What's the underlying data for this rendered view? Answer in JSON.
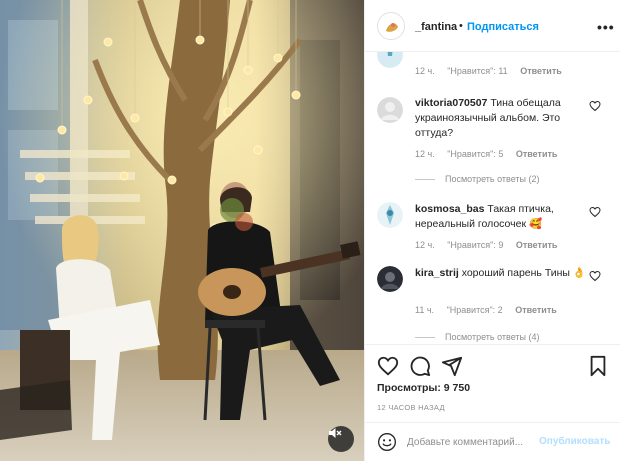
{
  "post": {
    "username": "_fantina",
    "separator": "•",
    "follow_label": "Подписаться",
    "more_label": "•••"
  },
  "comments": [
    {
      "partial": true,
      "meta": {
        "time": "12 ч.",
        "likes": "\"Нравится\": 11",
        "reply": "Ответить"
      }
    },
    {
      "username": "viktoria070507",
      "text": "Тина обещала украиноязычный альбом. Это оттуда?",
      "meta": {
        "time": "12 ч.",
        "likes": "\"Нравится\": 5",
        "reply": "Ответить"
      },
      "view_replies": "Посмотреть ответы (2)"
    },
    {
      "username": "kosmosa_bas",
      "text": "Такая птичка, нереальный голосочек 🥰",
      "meta": {
        "time": "12 ч.",
        "likes": "\"Нравится\": 9",
        "reply": "Ответить"
      }
    },
    {
      "username": "kira_strij",
      "text": "хороший парень Тины 👌",
      "meta": {
        "time": "11 ч.",
        "likes": "\"Нравится\": 2",
        "reply": "Ответить"
      },
      "view_replies": "Посмотреть ответы (4)"
    }
  ],
  "stats": {
    "views": "Просмотры: 9 750",
    "time_ago": "12 ЧАСОВ НАЗАД"
  },
  "add_comment": {
    "placeholder": "Добавьте комментарий...",
    "publish_label": "Опубликовать"
  },
  "icons": {
    "like": "heart-icon",
    "comment": "comment-icon",
    "share": "share-icon",
    "save": "bookmark-icon",
    "emoji": "emoji-icon",
    "mute": "speaker-muted-icon"
  },
  "colors": {
    "link": "#0095f6",
    "publish_disabled": "#b2dffc",
    "muted_text": "#8e8e8e"
  }
}
